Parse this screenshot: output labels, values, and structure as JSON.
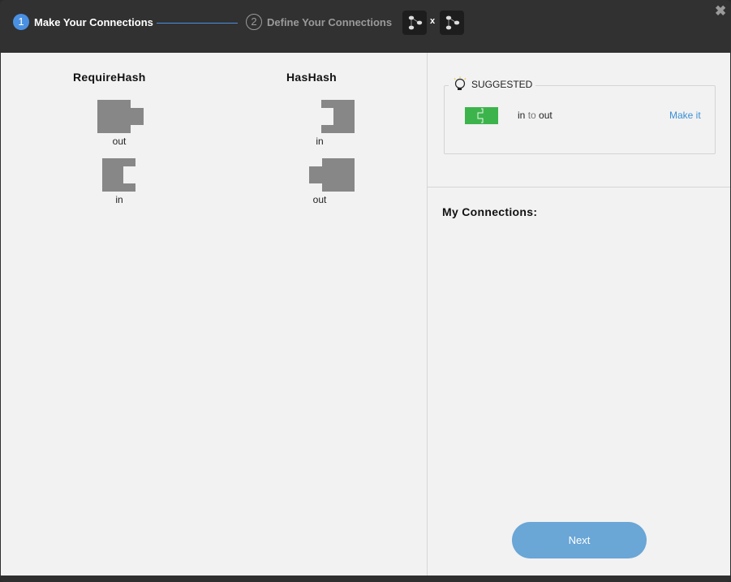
{
  "header": {
    "step1": {
      "number": "1",
      "label": "Make Your Connections"
    },
    "step2": {
      "number": "2",
      "label": "Define Your Connections"
    },
    "times_symbol": "x",
    "close_symbol": "✖"
  },
  "left": {
    "component_a": {
      "title": "RequireHash",
      "ports": [
        {
          "label": "out"
        },
        {
          "label": "in"
        }
      ]
    },
    "component_b": {
      "title": "HasHash",
      "ports": [
        {
          "label": "in"
        },
        {
          "label": "out"
        }
      ]
    }
  },
  "right": {
    "suggested": {
      "heading": "SUGGESTED",
      "from": "in",
      "to_word": "to",
      "to": "out",
      "action": "Make it"
    },
    "my_connections_label": "My Connections:",
    "next_label": "Next"
  },
  "colors": {
    "accent": "#4a90e2",
    "suggest_green": "#3cb44b",
    "link": "#3a8fd6",
    "button": "#6aa6d6",
    "port_gray": "#878787"
  }
}
